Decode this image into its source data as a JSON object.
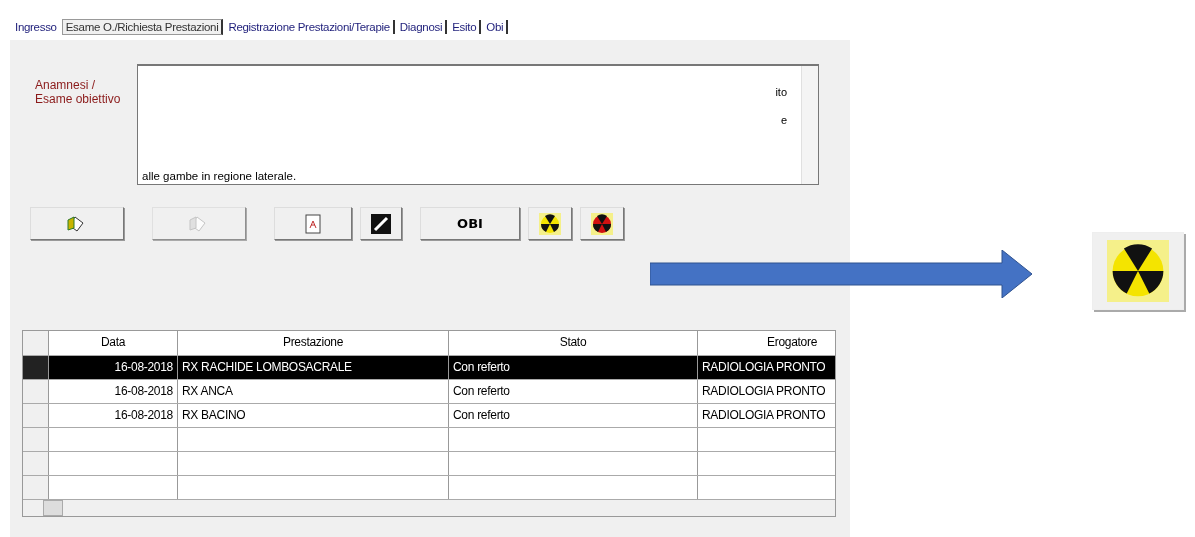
{
  "tabs": [
    {
      "label": "Ingresso",
      "selected": false
    },
    {
      "label": "Esame O./Richiesta Prestazioni",
      "selected": true
    },
    {
      "label": "Registrazione Prestazioni/Terapie",
      "selected": false
    },
    {
      "label": "Diagnosi",
      "selected": false
    },
    {
      "label": "Esito",
      "selected": false
    },
    {
      "label": "Obi",
      "selected": false
    }
  ],
  "anamnesi": {
    "label": "Anamnesi / Esame obiettivo",
    "fragments": [
      "ito",
      "e"
    ],
    "value": "alle gambe in regione laterale."
  },
  "buttons": [
    {
      "kind": "add",
      "disabled": false
    },
    {
      "kind": "remove",
      "disabled": true
    },
    {
      "kind": "report",
      "disabled": false
    },
    {
      "kind": "edit",
      "disabled": false
    },
    {
      "kind": "text",
      "label": "OBI",
      "disabled": false
    },
    {
      "kind": "radiation",
      "disabled": false
    },
    {
      "kind": "radiation-red",
      "disabled": false
    }
  ],
  "table": {
    "columns": [
      "Data",
      "Prestazione",
      "Stato",
      "Erogatore"
    ],
    "rows": [
      {
        "cells": [
          "16-08-2018",
          "RX RACHIDE LOMBOSACRALE",
          "Con referto",
          "RADIOLOGIA PRONTO"
        ],
        "selected": true
      },
      {
        "cells": [
          "16-08-2018",
          "RX ANCA",
          "Con referto",
          "RADIOLOGIA PRONTO"
        ],
        "selected": false
      },
      {
        "cells": [
          "16-08-2018",
          "RX BACINO",
          "Con referto",
          "RADIOLOGIA PRONTO"
        ],
        "selected": false
      }
    ]
  },
  "zoomed_button": {
    "kind": "radiation"
  }
}
